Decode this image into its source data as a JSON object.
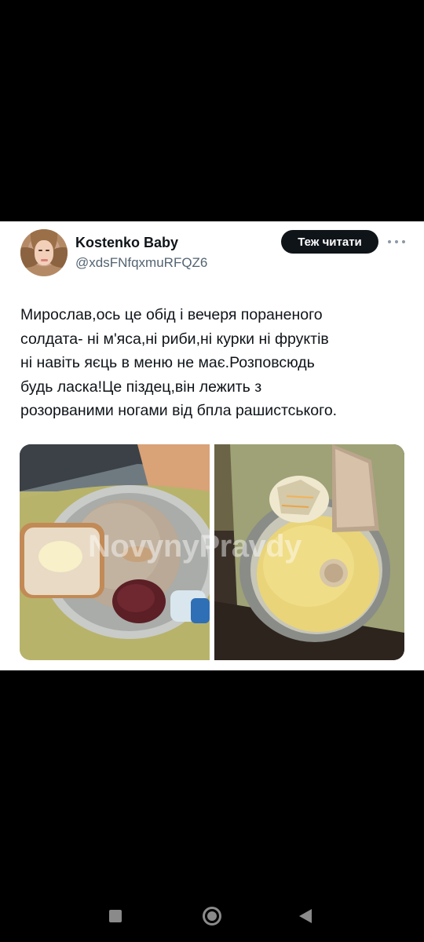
{
  "tweet": {
    "display_name": "Kostenko Baby",
    "handle": "@xdsFNfqxmuRFQZ6",
    "follow_label": "Теж читати",
    "text_lines": [
      "Мирослав,ось це обід і вечеря пораненого",
      "солдата- ні м'яса,ні риби,ні курки ні фруктів",
      "ні навіть яєць в меню не має.Розповсюдь",
      "будь ласка!Це піздец,він лежить з",
      "розорваними ногами від бпла рашистського."
    ],
    "media": {
      "watermark": "NovynyPravdy",
      "photos": [
        "photo-1",
        "photo-2"
      ]
    }
  },
  "icons": {
    "more": "more-icon",
    "nav_back": "square-nav-icon",
    "nav_home": "circle-home-icon",
    "nav_recent": "triangle-back-icon"
  },
  "colors": {
    "background": "#000000",
    "card": "#ffffff",
    "text": "#0f1419",
    "secondary": "#536471",
    "button": "#0f1419"
  }
}
